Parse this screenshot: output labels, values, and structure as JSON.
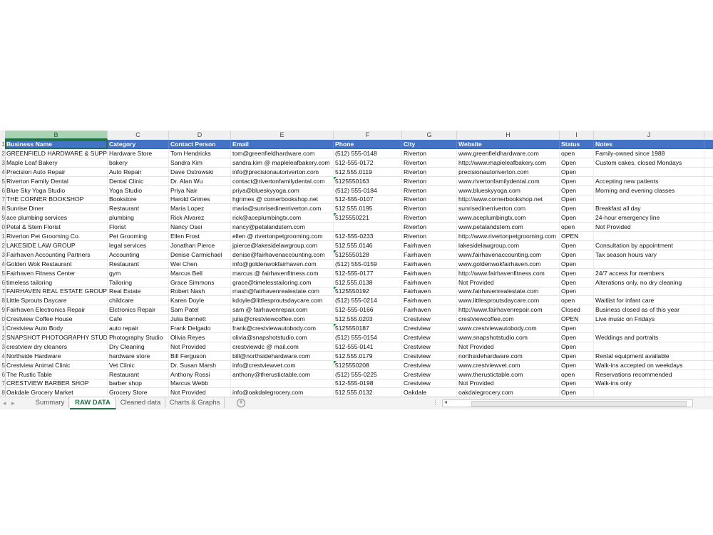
{
  "columns": [
    "B",
    "C",
    "D",
    "E",
    "F",
    "G",
    "H",
    "I",
    "J"
  ],
  "header": [
    "Business Name",
    "Category",
    "Contact Person",
    "Email",
    "Phone",
    "City",
    "Website",
    "Status",
    "Notes"
  ],
  "row_numbers": [
    "1",
    "2",
    "3",
    "4",
    "5",
    "6",
    "7",
    "8",
    "9",
    "0",
    "1",
    "2",
    "3",
    "4",
    "5",
    "6",
    "7",
    "8",
    "9",
    "0",
    "1",
    "2",
    "3",
    "4",
    "5",
    "6",
    "7",
    "8"
  ],
  "rows": [
    [
      "  GREENFIELD HARDWARE & SUPPLY",
      "Hardware Store",
      "Tom Hendricks",
      "tom@greenfieldhardware.com",
      "(512) 555-0148",
      "Riverton",
      "www.greenfieldhardware.com",
      "open",
      "Family-owned since 1988"
    ],
    [
      "Maple Leaf Bakery",
      "bakery",
      "Sandra Kim",
      " sandra.kim @ mapleleafbakery.com",
      "512-555-0172",
      "Riverton",
      "http://www.mapleleafbakery.com",
      "Open",
      "Custom cakes, closed Mondays"
    ],
    [
      "Precision Auto Repair",
      "Auto  Repair",
      "Dave Ostrowski",
      "info@precisionautoriverton.com",
      "512.555.0119",
      "Riverton",
      "precisionautoriverton.com",
      "Open",
      ""
    ],
    [
      "Riverton Family Dental",
      "Dental Clinic",
      "Dr. Alan Wu",
      "contact@rivertonfamilydental.com",
      "5125550163",
      "Riverton",
      "www.rivertonfamilydental.com",
      "Open",
      "Accepting new patients"
    ],
    [
      "Blue Sky Yoga Studio",
      "Yoga Studio",
      "Priya Nair",
      "priya@blueskyyoga.com",
      "(512) 555-0184",
      "Riverton",
      "www.blueskyyoga.com",
      "Open",
      "Morning and evening classes"
    ],
    [
      " THE CORNER BOOKSHOP",
      "Bookstore",
      "Harold Grimes",
      " hgrimes @ cornerbookshop.net",
      "512-555-0107",
      "Riverton",
      "http://www.cornerbookshop.net",
      "Open",
      ""
    ],
    [
      "  Sunrise Diner",
      "Restaurant",
      "Maria Lopez",
      "maria@sunrisedinerriverton.com",
      "512.555.0195",
      "Riverton",
      "sunrisedinerriverton.com",
      "Open",
      "Breakfast all day"
    ],
    [
      " ace plumbing services",
      "plumbing",
      "Rick Alvarez",
      "rick@aceplumbingtx.com",
      "5125550221",
      "Riverton",
      "www.aceplumbingtx.com",
      "Open",
      "24-hour emergency line"
    ],
    [
      "Petal & Stem Florist",
      "Florist",
      "Nancy Osei",
      "nancy@petalandstem.com",
      "",
      "Riverton",
      "www.petalandstem.com",
      "open",
      "Not Provided"
    ],
    [
      "Riverton Pet Grooming Co.",
      "Pet Grooming",
      "Ellen Frost",
      " ellen @ rivertonpetgrooming.com",
      "512-555-0233",
      "Riverton",
      "http://www.rivertonpetgrooming.com",
      "OPEN",
      ""
    ],
    [
      " LAKESIDE LAW GROUP",
      "legal services",
      "Jonathan Pierce",
      "jpierce@lakesidelawgroup.com",
      "512.555.0146",
      "Fairhaven",
      "lakesidelawgroup.com",
      "Open",
      "Consultation by appointment"
    ],
    [
      "Fairhaven Accounting Partners",
      "Accounting",
      "Denise Carmichael",
      "denise@fairhavenaccounting.com",
      "5125550128",
      "Fairhaven",
      "www.fairhavenaccounting.com",
      "Open",
      "Tax season hours vary"
    ],
    [
      "  Golden Wok Restaurant",
      "Restaurant",
      "Wei Chen",
      "info@goldenwokfairhaven.com",
      "(512) 555-0159",
      "Fairhaven",
      "www.goldenwokfairhaven.com",
      "Open",
      ""
    ],
    [
      "Fairhaven Fitness Center",
      "gym",
      "Marcus Bell",
      " marcus @ fairhavenfitness.com",
      "512-555-0177",
      "Fairhaven",
      "http://www.fairhavenfitness.com",
      "Open",
      "24/7 access for members"
    ],
    [
      " timeless tailoring",
      "Tailoring",
      "Grace Simmons",
      "grace@timelesstailoring.com",
      "512.555.0138",
      "Fairhaven",
      "Not Provided",
      "Open",
      "Alterations only, no dry cleaning"
    ],
    [
      " FAIRHAVEN REAL ESTATE GROUP",
      "Real Estate",
      "Robert Nash",
      "rnash@fairhavenrealestate.com",
      "5125550192",
      "Fairhaven",
      "www.fairhavenrealestate.com",
      "Open",
      ""
    ],
    [
      "Little Sprouts Daycare",
      "childcare",
      "Karen Doyle",
      "kdoyle@littlesproutsdaycare.com",
      "(512) 555-0214",
      "Fairhaven",
      "www.littlesproutsdaycare.com",
      "open",
      "Waitlist for infant care"
    ],
    [
      "Fairhaven Electronics Repair",
      "Elctronics Repair",
      "Sam Patel",
      " sam @ fairhavenrepair.com",
      "512-555-0166",
      "Fairhaven",
      "http://www.fairhavenrepair.com",
      "Closed",
      "Business closed as of this year"
    ],
    [
      "  Crestview Coffee House",
      "Cafe",
      "Julia Bennett",
      "julia@crestviewcoffee.com",
      "512.555.0203",
      "Crestview",
      "crestviewcoffee.com",
      "OPEN",
      "Live music on Fridays"
    ],
    [
      "Crestview Auto Body",
      "auto repair",
      "Frank Delgado",
      "frank@crestviewautobody.com",
      "5125550187",
      "Crestview",
      "www.crestviewautobody.com",
      "Open",
      ""
    ],
    [
      " SNAPSHOT PHOTOGRAPHY STUDIO",
      "Photography Studio",
      "Olivia Reyes",
      "olivia@snapshotstudio.com",
      "(512) 555-0154",
      "Crestview",
      "www.snapshotstudio.com",
      "Open",
      "Weddings and portraits"
    ],
    [
      " crestview dry cleaners",
      "Dry Cleaning",
      "Not Provided",
      " crestviewdc @ mail.com",
      "512-555-0141",
      "Crestview",
      "Not Provided",
      "Open",
      ""
    ],
    [
      "Northside Hardware",
      "hardware store",
      "Bill Ferguson",
      "bill@northsidehardware.com",
      "512.555.0179",
      "Crestview",
      "northsidehardware.com",
      "Open",
      "Rental equipment available"
    ],
    [
      "Crestview Animal Clinic",
      "Vet Clinic",
      "Dr. Susan Marsh",
      "info@crestviewvet.com",
      "5125550208",
      "Crestview",
      "www.crestviewvet.com",
      "Open",
      "Walk-ins accepted on weekdays"
    ],
    [
      "  The Rustic Table",
      "Restaurant",
      "Anthony Rossi",
      "anthony@therustictable.com",
      "(512) 555-0225",
      "Crestview",
      "www.therustictable.com",
      "open",
      "Reservations recommended"
    ],
    [
      " CRESTVIEW BARBER SHOP",
      "barber shop",
      "Marcus Webb",
      "",
      "512-555-0198",
      "Crestview",
      "Not Provided",
      "Open",
      "Walk-ins only"
    ],
    [
      "Oakdale Grocery Market",
      "Grocery Store",
      "Not Provided",
      "info@oakdalegrocery.com",
      "512.555.0132",
      "Oakdale",
      "oakdalegrocery.com",
      "Open",
      ""
    ]
  ],
  "tabs": [
    "Summary",
    "RAW DATA",
    "Cleaned data",
    "Charts & Graphs"
  ],
  "active_tab": "RAW DATA",
  "colors": {
    "header_bg": "#4472c4",
    "accent": "#217346",
    "selected_col": "#a9d4b4"
  }
}
